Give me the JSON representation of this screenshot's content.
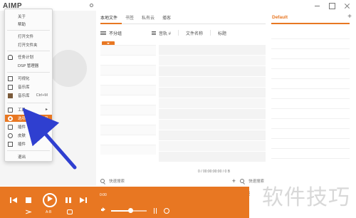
{
  "app": {
    "brand": "AIMP"
  },
  "context_menu": {
    "items": [
      {
        "label": "关于",
        "shortcut": ""
      },
      {
        "label": "帮助",
        "shortcut": ""
      },
      {
        "label": "打开文件",
        "shortcut": ""
      },
      {
        "label": "打开文件夹",
        "shortcut": ""
      },
      {
        "label": "任务计划",
        "shortcut": ""
      },
      {
        "label": "DSP 管理器",
        "shortcut": ""
      },
      {
        "label": "可视化",
        "shortcut": ""
      },
      {
        "label": "音乐库",
        "shortcut": ""
      },
      {
        "label": "音乐库",
        "shortcut": "Ctrl+M"
      },
      {
        "label": "工具",
        "shortcut": ""
      },
      {
        "label": "选项",
        "shortcut": "Ctrl+P"
      },
      {
        "label": "插件",
        "shortcut": ""
      },
      {
        "label": "皮肤",
        "shortcut": ""
      },
      {
        "label": "插件",
        "shortcut": ""
      },
      {
        "label": "退出",
        "shortcut": ""
      }
    ]
  },
  "tabs": [
    "本地文件",
    "书签",
    "私有云",
    "播客"
  ],
  "playlist_name": "Default",
  "group": {
    "header": "不分组"
  },
  "columns": [
    "音轨 #",
    "文件名称",
    "标题"
  ],
  "timecode": "0 / 00:00:00:00 / 0 B",
  "search": {
    "placeholder": "快速搜索"
  },
  "search2": {
    "placeholder": "快速搜索"
  },
  "player": {
    "time_left": "0:00",
    "speed": "A-B"
  },
  "volume": {
    "level": 0.55
  },
  "watermark": "软件技巧",
  "colors": {
    "accent": "#e87722"
  }
}
